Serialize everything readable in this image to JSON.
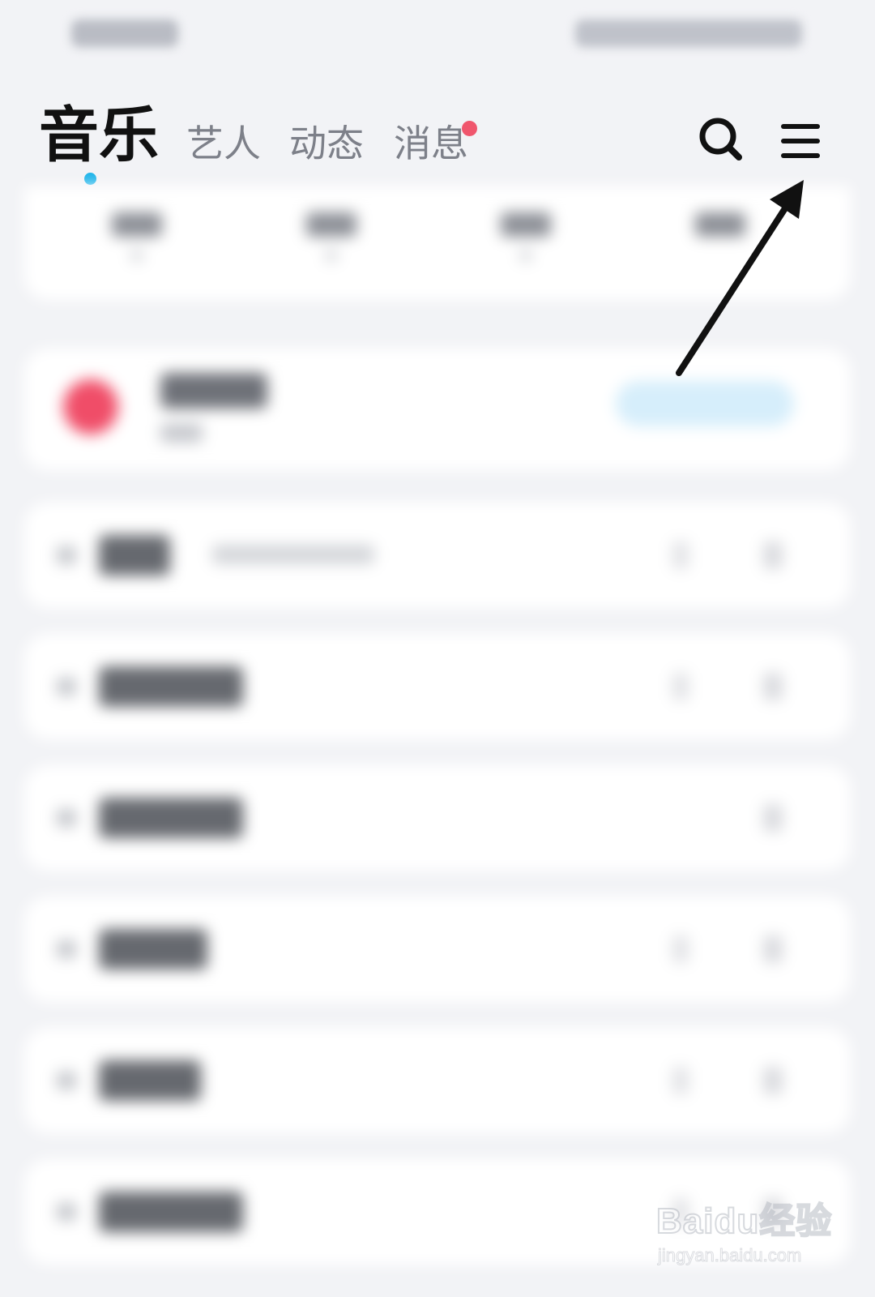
{
  "header": {
    "tabs": [
      {
        "label": "音乐",
        "active": true
      },
      {
        "label": "艺人",
        "active": false
      },
      {
        "label": "动态",
        "active": false
      },
      {
        "label": "消息",
        "active": false,
        "has_unread_badge": true
      }
    ],
    "actions": [
      {
        "icon": "search-icon"
      },
      {
        "icon": "menu-icon"
      }
    ]
  },
  "colors": {
    "active_tab_text": "#111111",
    "inactive_tab_text": "#7d8089",
    "active_indicator": "#1eb4ea",
    "unread_badge": "#f0566d",
    "favorites_icon": "#f04d68",
    "annotation_arrow": "#111111",
    "background": "#f2f3f6"
  },
  "content": {
    "blurred": true,
    "quick_entries_count": 4,
    "list_rows_count": 6
  },
  "annotation": {
    "type": "arrow",
    "points_to": "menu-icon"
  },
  "watermark": {
    "logo": "Baidu经验",
    "url": "jingyan.baidu.com"
  }
}
